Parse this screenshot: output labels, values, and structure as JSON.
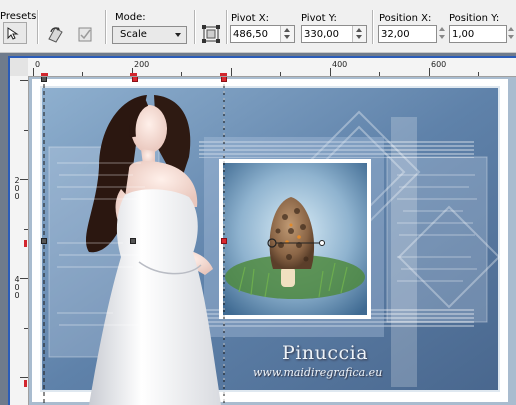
{
  "toolbar": {
    "presets_label": "Presets:",
    "mode_label": "Mode:",
    "mode_value": "Scale",
    "pivot_x_label": "Pivot X:",
    "pivot_x_value": "486,50",
    "pivot_y_label": "Pivot Y:",
    "pivot_y_value": "330,00",
    "position_x_label": "Position X:",
    "position_x_value": "32,00",
    "position_y_label": "Position Y:",
    "position_y_value": "1,00",
    "icons": [
      "pointer-preset-icon",
      "reset-transform-icon",
      "apply-transform-icon",
      "pivot-options-icon"
    ]
  },
  "ruler": {
    "horizontal_labels": [
      "0",
      "200",
      "400",
      "600"
    ],
    "vertical_labels": [
      "2\n0\n0",
      "4\n0\n0"
    ]
  },
  "canvas": {
    "watermark_title": "Pinuccia",
    "watermark_url": "www.maidiregrafica.eu"
  },
  "colors": {
    "accent_window_border": "#2b5cb8",
    "handle_red": "#d9262e",
    "background_blue": "#5a7ea8"
  }
}
